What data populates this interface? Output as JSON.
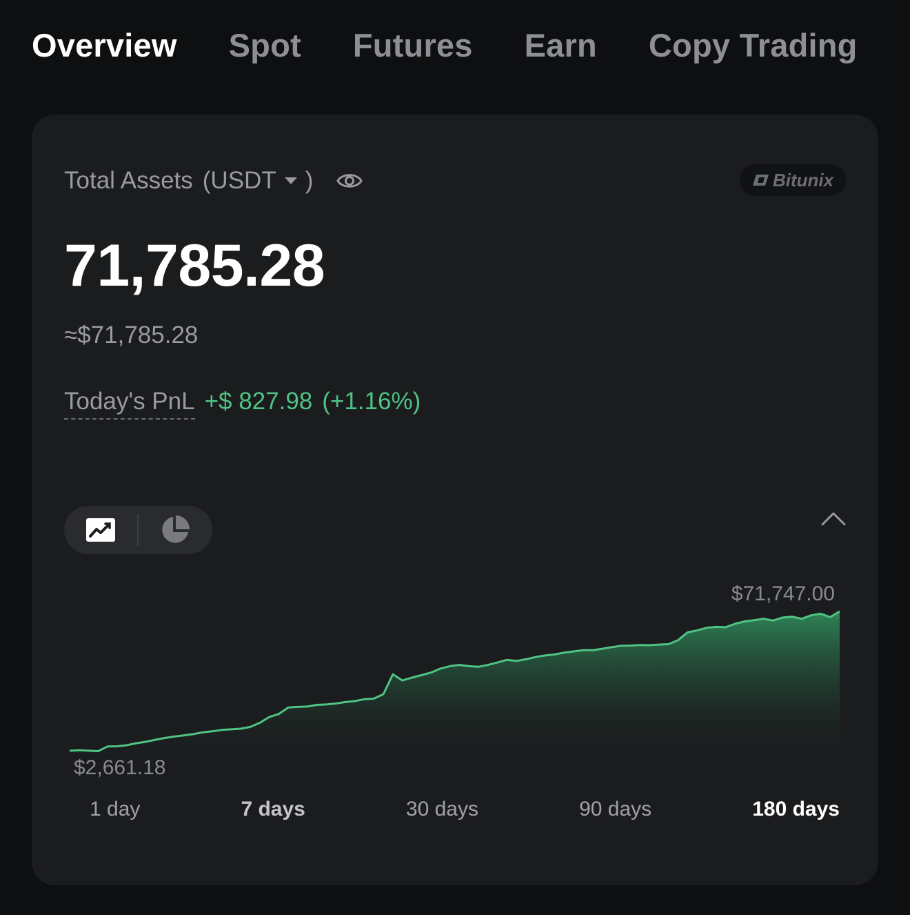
{
  "tabs": [
    {
      "label": "Overview",
      "active": true
    },
    {
      "label": "Spot",
      "active": false
    },
    {
      "label": "Futures",
      "active": false
    },
    {
      "label": "Earn",
      "active": false
    },
    {
      "label": "Copy Trading",
      "active": false
    }
  ],
  "assets": {
    "label": "Total Assets",
    "currency_open": "(USDT",
    "currency_close": ")",
    "visibility_icon": "eye-icon",
    "brand": "Bitunix",
    "total": "71,785.28",
    "approx": "≈$71,785.28"
  },
  "pnl": {
    "label": "Today's PnL",
    "value": "+$ 827.98",
    "percent": "(+1.16%)"
  },
  "chart_controls": {
    "line_icon": "line-chart-icon",
    "pie_icon": "pie-chart-icon",
    "collapse_icon": "chevron-up-icon"
  },
  "chart_data": {
    "type": "area",
    "max_label": "$71,747.00",
    "min_label": "$2,661.18",
    "ylim": [
      2661.18,
      71747.0
    ],
    "color": "#4fc484",
    "y": [
      2661.18,
      2900,
      2700,
      2500,
      4800,
      4900,
      5400,
      6400,
      7100,
      8100,
      9000,
      9700,
      10300,
      10900,
      11800,
      12300,
      13000,
      13300,
      13600,
      14500,
      16500,
      19400,
      20900,
      24100,
      24400,
      24600,
      25400,
      25600,
      26100,
      26800,
      27300,
      28200,
      28500,
      30700,
      40600,
      37500,
      38900,
      40100,
      41400,
      43400,
      44600,
      45200,
      44600,
      44300,
      45200,
      46400,
      47700,
      47200,
      48000,
      49100,
      49900,
      50400,
      51300,
      51900,
      52500,
      52500,
      53200,
      54000,
      54700,
      54800,
      55100,
      55000,
      55300,
      55500,
      57500,
      61400,
      62300,
      63600,
      64100,
      63900,
      65600,
      66800,
      67400,
      68100,
      67200,
      68700,
      69100,
      68100,
      69800,
      70600,
      68900,
      71747.0
    ]
  },
  "ranges": [
    {
      "label": "1 day",
      "state": ""
    },
    {
      "label": "7 days",
      "state": "semi"
    },
    {
      "label": "30 days",
      "state": ""
    },
    {
      "label": "90 days",
      "state": ""
    },
    {
      "label": "180 days",
      "state": "active"
    }
  ]
}
